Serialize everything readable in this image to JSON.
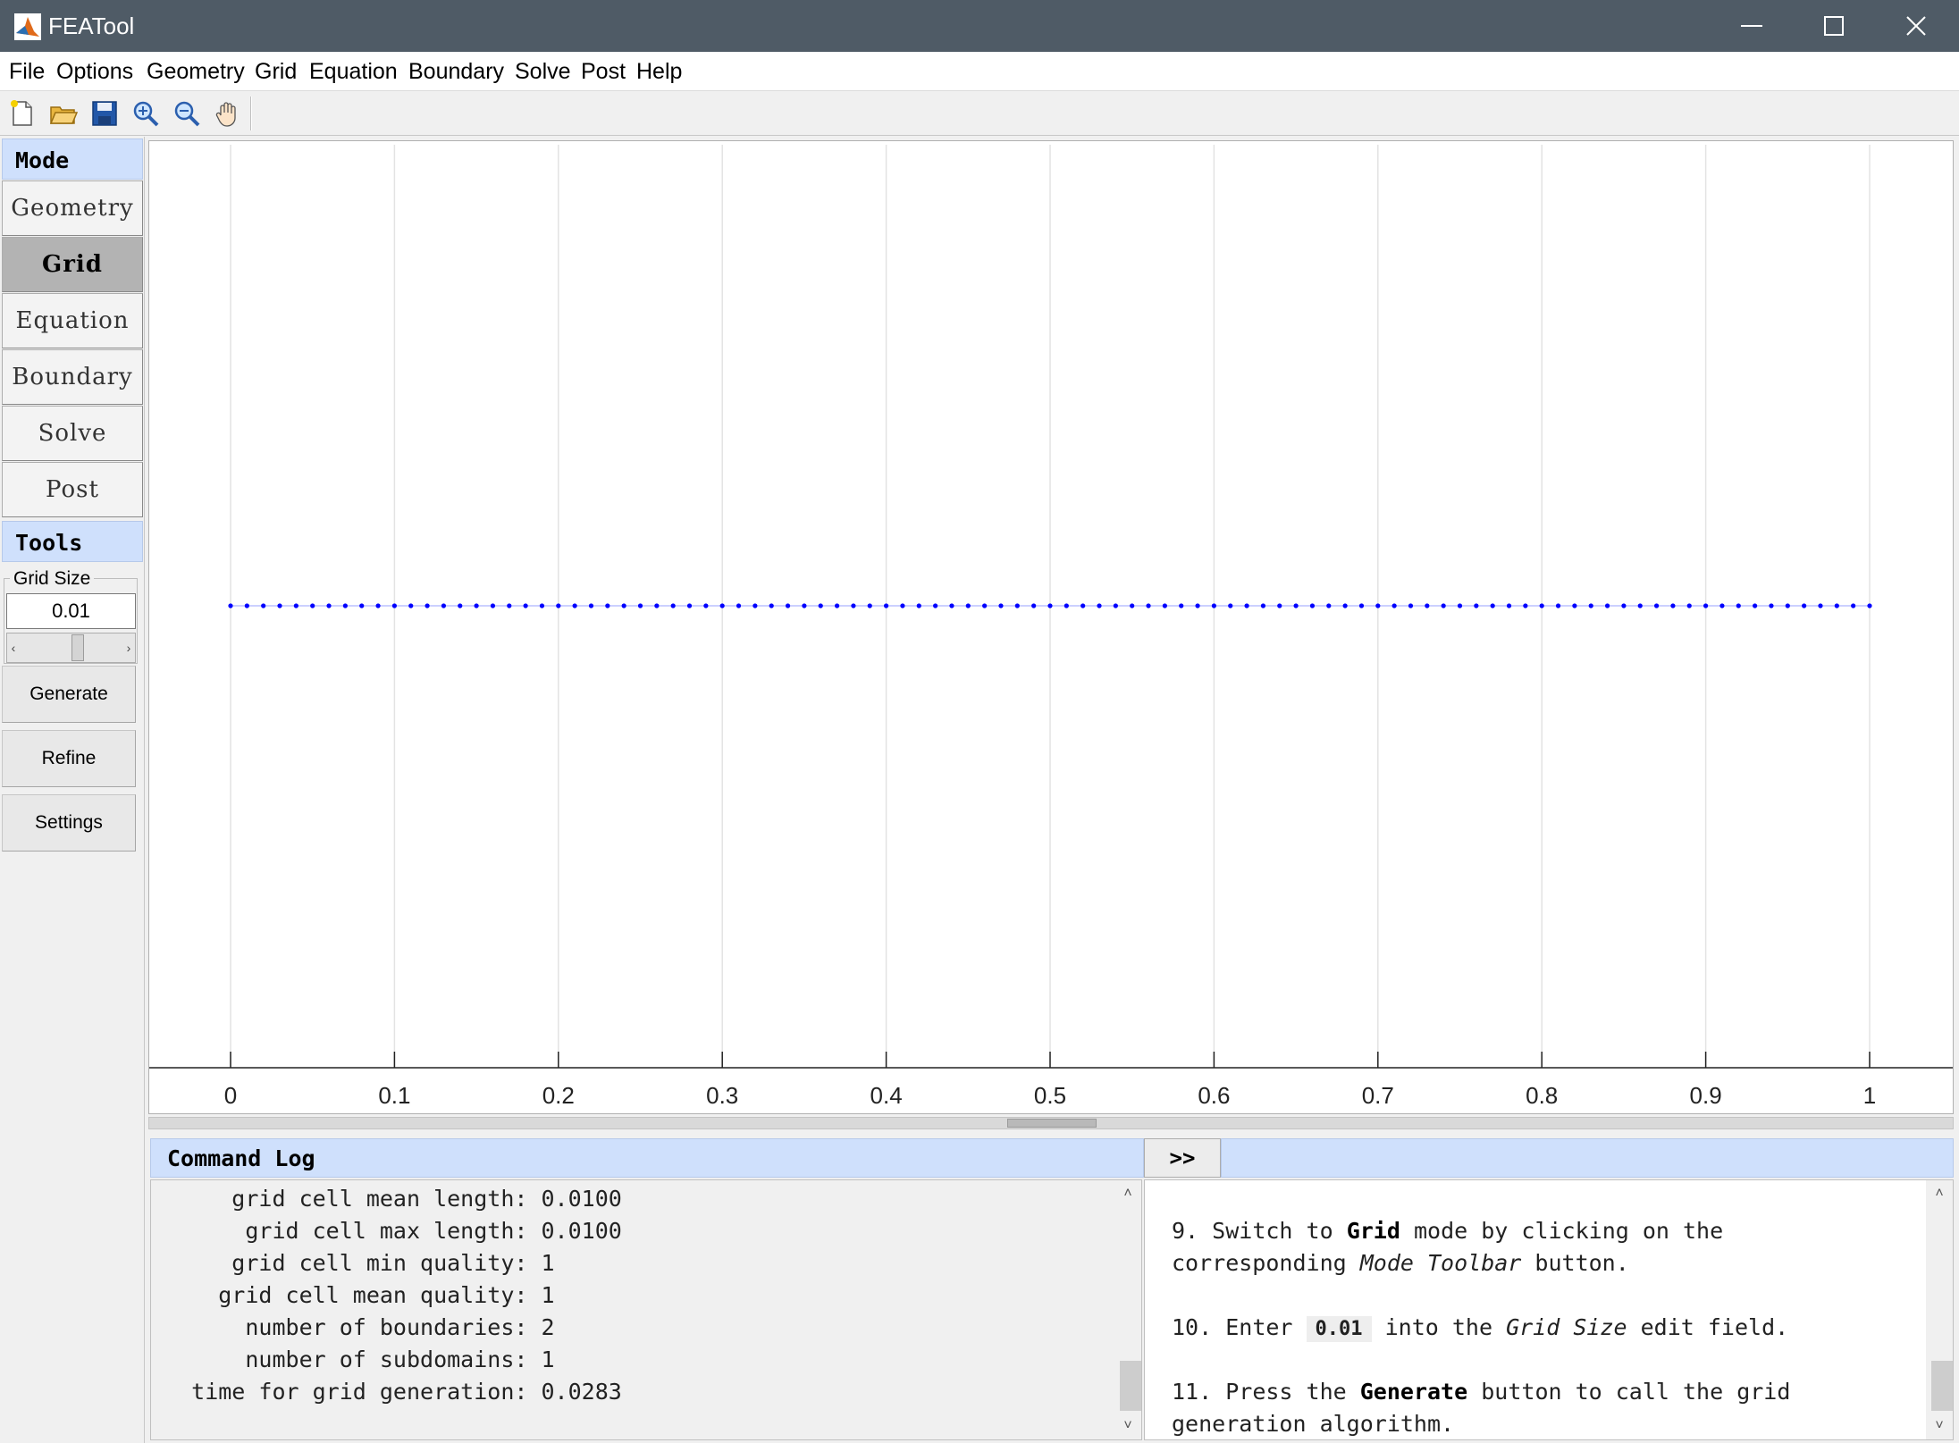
{
  "window": {
    "title": "FEATool"
  },
  "menu": [
    "File",
    "Options",
    "Geometry",
    "Grid",
    "Equation",
    "Boundary",
    "Solve",
    "Post",
    "Help"
  ],
  "toolbar": {
    "icons": [
      "new-file-icon",
      "open-folder-icon",
      "save-icon",
      "zoom-in-icon",
      "zoom-out-icon",
      "pan-hand-icon"
    ]
  },
  "left_panel": {
    "mode_header": "Mode",
    "modes": [
      "Geometry",
      "Grid",
      "Equation",
      "Boundary",
      "Solve",
      "Post"
    ],
    "active_mode": "Grid",
    "tools_header": "Tools",
    "grid_size_label": "Grid Size",
    "grid_size_value": "0.01",
    "buttons": [
      "Generate",
      "Refine",
      "Settings"
    ]
  },
  "chart_data": {
    "type": "scatter",
    "x_range": [
      0,
      1
    ],
    "x_ticks": [
      "0",
      "0.1",
      "0.2",
      "0.3",
      "0.4",
      "0.5",
      "0.6",
      "0.7",
      "0.8",
      "0.9",
      "1"
    ],
    "grid": "vertical",
    "series": [
      {
        "x_start": 0,
        "x_end": 1,
        "step": 0.01,
        "y": 0,
        "color": "#0000ff"
      }
    ]
  },
  "command_log": {
    "header": "Command Log",
    "expand_label": ">>",
    "lines": [
      "      grid cell mean length: 0.0100",
      "       grid cell max length: 0.0100",
      "      grid cell min quality: 1",
      "     grid cell mean quality: 1",
      "       number of boundaries: 2",
      "       number of subdomains: 1",
      "   time for grid generation: 0.0283"
    ]
  },
  "tutorial": {
    "step9_num": "9.",
    "step9_a": "Switch to",
    "step9_b": "Grid",
    "step9_c": "mode by clicking on the",
    "step9_d": "corresponding",
    "step9_e": "Mode Toolbar",
    "step9_f": "button.",
    "step10_num": "10.",
    "step10_a": "Enter",
    "step10_b": "0.01",
    "step10_c": "into the",
    "step10_d": "Grid Size",
    "step10_e": "edit field.",
    "step11_num": "11.",
    "step11_a": "Press the",
    "step11_b": "Generate",
    "step11_c": "button to call the grid",
    "step11_d": "generation algorithm."
  },
  "colors": {
    "header_blue": "#cfe0fc",
    "titlebar": "#4f5b66",
    "grid_point": "#0000ff"
  }
}
